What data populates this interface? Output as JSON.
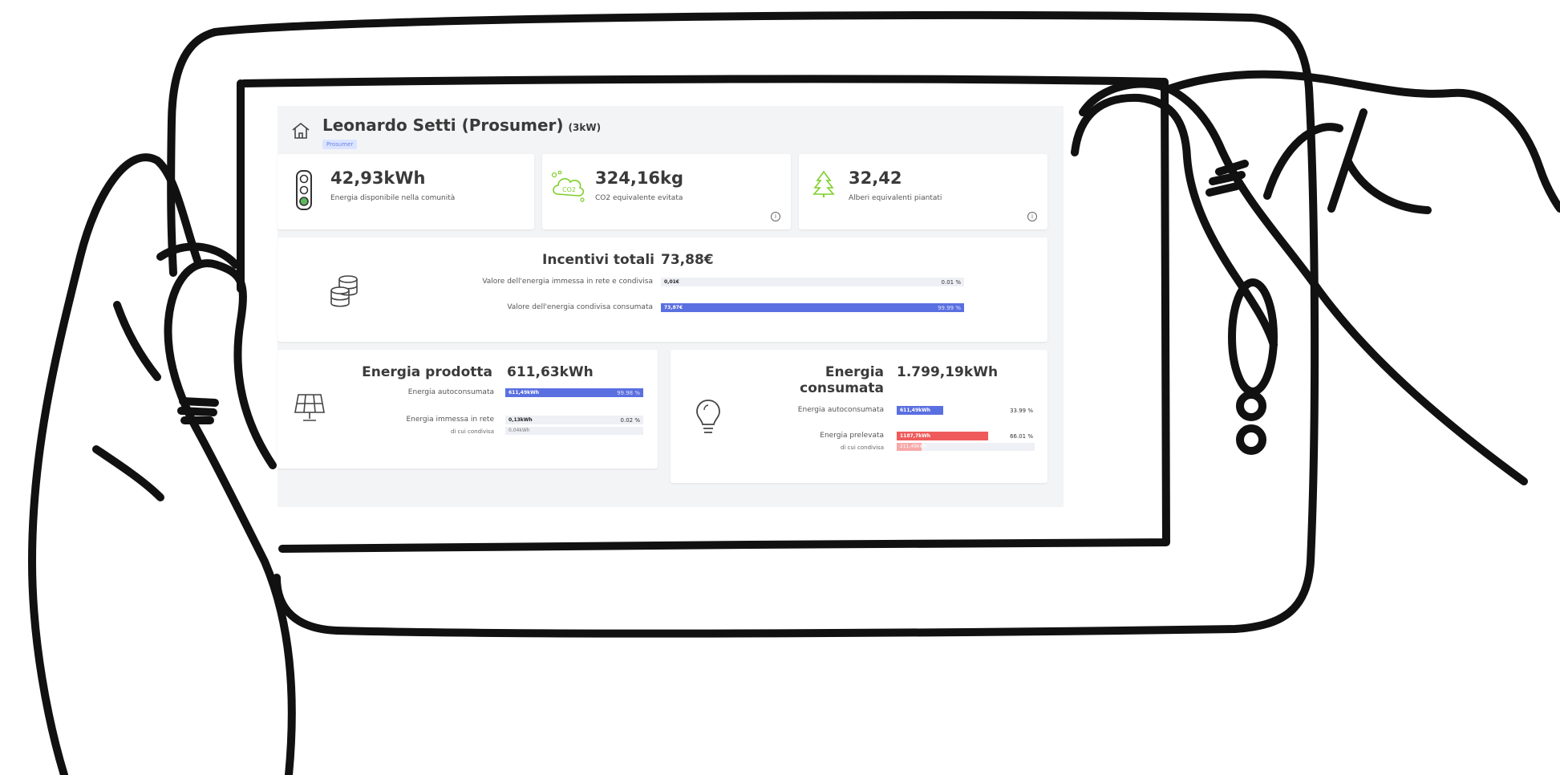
{
  "user": {
    "name": "Leonardo Setti (Prosumer)",
    "power": "(3kW)",
    "role_badge": "Prosumer"
  },
  "stats": [
    {
      "value": "42,93kWh",
      "label": "Energia disponibile nella comunità",
      "icon": "traffic-light-icon"
    },
    {
      "value": "324,16kg",
      "label": "CO2 equivalente evitata",
      "icon": "cloud-co2-icon"
    },
    {
      "value": "32,42",
      "label": "Alberi equivalenti piantati",
      "icon": "tree-icon"
    }
  ],
  "incentives": {
    "title": "Incentivi totali",
    "total": "73,88€",
    "rows": [
      {
        "label": "Valore dell'energia immessa in rete e condivisa",
        "bar_value": "0,01€",
        "percent": "0.01 %",
        "fraction": 0.0001
      },
      {
        "label": "Valore dell'energia condivisa consumata",
        "bar_value": "73,87€",
        "percent": "99.99 %",
        "fraction": 0.9999
      }
    ]
  },
  "produced": {
    "title": "Energia prodotta",
    "total": "611,63kWh",
    "self_label": "Energia autoconsumata",
    "self_value": "611,49kWh",
    "self_percent": "99.98 %",
    "self_fraction": 0.9998,
    "grid_label": "Energia immessa in rete",
    "grid_value": "0,13kWh",
    "grid_percent": "0.02 %",
    "grid_fraction": 0.0002,
    "shared_label": "di cui condivisa",
    "shared_value": "0,04kWh"
  },
  "consumed": {
    "title_line1": "Energia",
    "title_line2": "consumata",
    "total": "1.799,19kWh",
    "self_label": "Energia autoconsumata",
    "self_value": "611,49kWh",
    "self_percent": "33.99 %",
    "self_fraction": 0.3399,
    "withdrawn_label": "Energia prelevata",
    "withdrawn_value": "1187,7kWh",
    "withdrawn_percent": "66.01 %",
    "withdrawn_fraction": 0.6601,
    "shared_label": "di cui condivisa",
    "shared_value": "211,49kWh",
    "shared_fraction": 0.18
  },
  "colors": {
    "blue": "#5a6fe0",
    "red": "#ef5b5b",
    "pink": "#f7a8a8",
    "green_icon": "#7fcf2a",
    "badge_bg": "#dbe4ff"
  }
}
